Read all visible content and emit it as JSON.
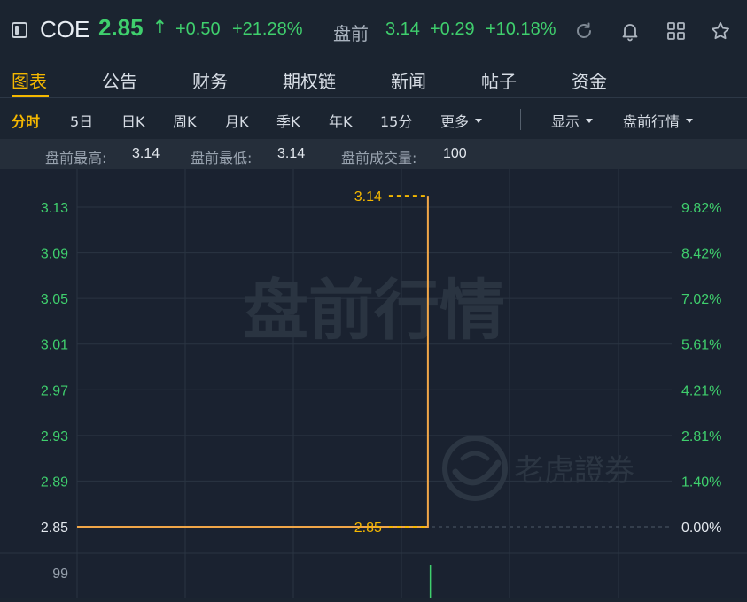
{
  "header": {
    "ticker": "COE",
    "price": "2.85",
    "price_arrow": "↑",
    "change": "+0.50",
    "change_pct": "+21.28%",
    "premarket_label": "盘前",
    "premarket_price": "3.14",
    "premarket_change": "+0.29",
    "premarket_change_pct": "+10.18%",
    "icons": [
      "panel-toggle-icon",
      "refresh-icon",
      "bell-icon",
      "grid-icon",
      "star-icon"
    ]
  },
  "tabs": [
    {
      "label": "图表",
      "active": true
    },
    {
      "label": "公告",
      "active": false
    },
    {
      "label": "财务",
      "active": false
    },
    {
      "label": "期权链",
      "active": false
    },
    {
      "label": "新闻",
      "active": false
    },
    {
      "label": "帖子",
      "active": false
    },
    {
      "label": "资金",
      "active": false
    }
  ],
  "periods": {
    "items": [
      "分时",
      "5日",
      "日K",
      "周K",
      "月K",
      "季K",
      "年K",
      "15分"
    ],
    "active": "分时",
    "more": "更多",
    "display": "显示",
    "premarket_quote": "盘前行情"
  },
  "stats": {
    "high_label": "盘前最高:",
    "high_value": "3.14",
    "low_label": "盘前最低:",
    "low_value": "3.14",
    "volume_label": "盘前成交量:",
    "volume_value": "100"
  },
  "watermarks": {
    "main": "盘前行情",
    "brand": "老虎證券"
  },
  "colors": {
    "background": "#1a2230",
    "up": "#3fcf6d",
    "accent": "#f5b800",
    "price_line": "#f0a648"
  },
  "chart_data": {
    "type": "line",
    "title": "",
    "y_left_ticks": [
      "3.13",
      "3.09",
      "3.05",
      "3.01",
      "2.97",
      "2.93",
      "2.89",
      "2.85"
    ],
    "y_right_ticks": [
      "9.82%",
      "8.42%",
      "7.02%",
      "5.61%",
      "4.21%",
      "2.81%",
      "1.40%",
      "0.00%"
    ],
    "ylim": [
      2.85,
      3.14
    ],
    "baseline": 2.85,
    "series": [
      {
        "points": [
          {
            "x": 0,
            "y": 2.85
          },
          {
            "x": 0.59,
            "y": 2.85
          },
          {
            "x": 0.59,
            "y": 3.14
          }
        ]
      }
    ],
    "markers": [
      {
        "label": "3.14",
        "value": 3.14
      },
      {
        "label": "2.85",
        "value": 2.85
      }
    ],
    "volume": {
      "axis_label": "99",
      "bars": [
        {
          "x": 0.59,
          "value": 100
        }
      ]
    }
  }
}
